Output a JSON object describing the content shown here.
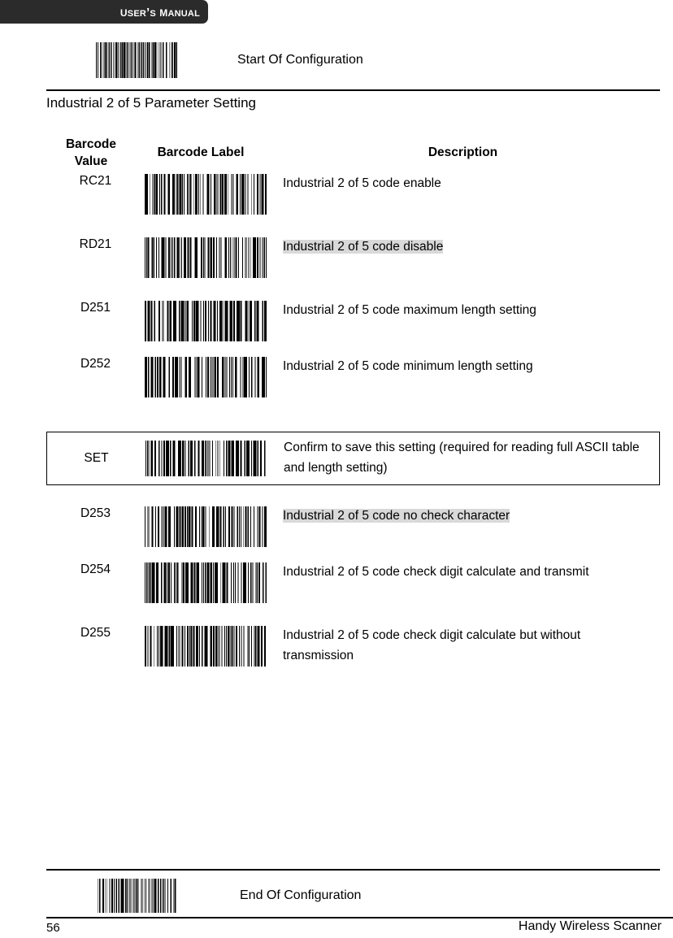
{
  "header": {
    "title": "USER’S MANUAL",
    "title_words": [
      "USER’S",
      "MANUAL"
    ]
  },
  "start_config": {
    "label": "Start Of Configuration",
    "barcode_name": "start-of-configuration-barcode"
  },
  "end_config": {
    "label": "End Of Configuration",
    "barcode_name": "end-of-configuration-barcode"
  },
  "section": {
    "title": "Industrial 2 of 5 Parameter Setting"
  },
  "table": {
    "headers": {
      "value": "Barcode Value",
      "value_line1": "Barcode",
      "value_line2": "Value",
      "label": "Barcode Label",
      "description": "Description"
    },
    "rows": [
      {
        "value": "RC21",
        "description": "Industrial 2 of 5 code enable",
        "highlighted": false
      },
      {
        "value": "RD21",
        "description": "Industrial 2 of 5 code disable",
        "highlighted": true
      },
      {
        "value": "D251",
        "description": "Industrial 2 of 5 code maximum length setting",
        "highlighted": false
      },
      {
        "value": "D252",
        "description": "Industrial 2 of 5 code minimum length setting",
        "highlighted": false
      },
      {
        "value": "D253",
        "description": "Industrial 2 of 5 code no check character",
        "highlighted": true
      },
      {
        "value": "D254",
        "description": "Industrial 2 of 5 code check digit calculate and transmit",
        "highlighted": false
      },
      {
        "value": "D255",
        "description": "Industrial 2 of 5 code check digit calculate but without transmission",
        "highlighted": false
      }
    ],
    "set_row": {
      "value": "SET",
      "description": "Confirm to save this setting (required for reading full ASCII table and length setting)",
      "boxed": true
    }
  },
  "footer": {
    "page_number": "56",
    "product": "Handy Wireless Scanner"
  },
  "colors": {
    "header_background": "#2b2b2b",
    "header_text": "#ffffff",
    "highlight": "#d9d9d9",
    "rule": "#000000",
    "text": "#000000",
    "page_background": "#ffffff"
  }
}
